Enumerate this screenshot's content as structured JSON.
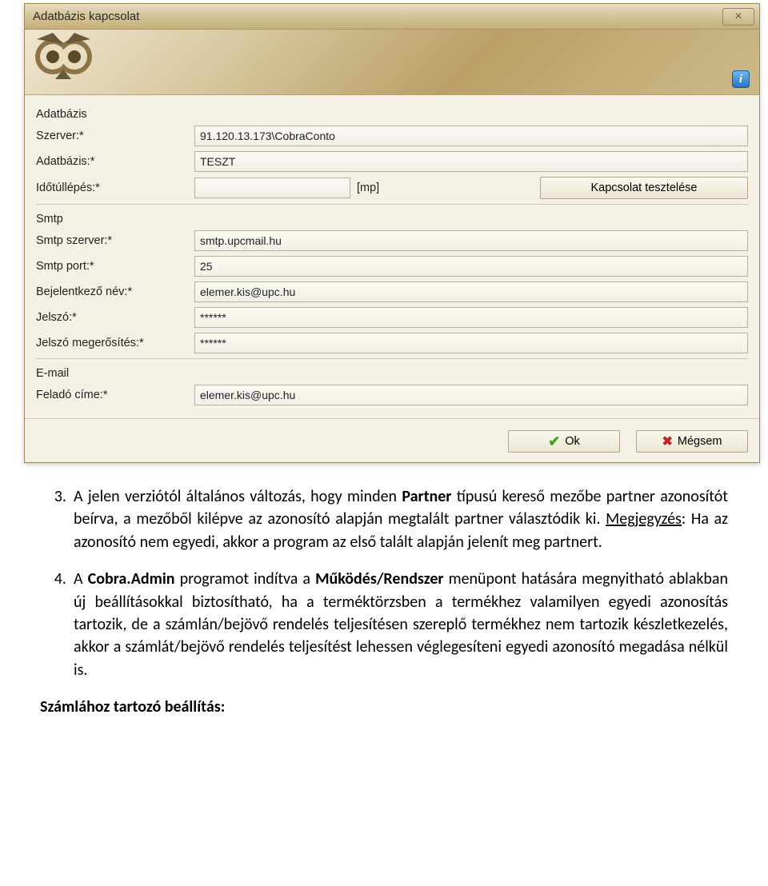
{
  "dialog": {
    "title": "Adatbázis kapcsolat",
    "info_char": "i",
    "close_char": "×",
    "sections": {
      "db": {
        "heading": "Adatbázis",
        "server_label": "Szerver:*",
        "server_value": "91.120.13.173\\CobraConto",
        "db_label": "Adatbázis:*",
        "db_value": "TESZT",
        "timeout_label": "Időtúllépés:*",
        "timeout_value": "",
        "timeout_unit": "[mp]",
        "test_btn": "Kapcsolat tesztelése"
      },
      "smtp": {
        "heading": "Smtp",
        "server_label": "Smtp szerver:*",
        "server_value": "smtp.upcmail.hu",
        "port_label": "Smtp port:*",
        "port_value": "25",
        "login_label": "Bejelntkező név:*",
        "login_label_fix": "Bejelentkező név:*",
        "login_value": "elemer.kis@upc.hu",
        "pass_label": "Jelszó:*",
        "pass_value": "******",
        "pass2_label": "Jelszó megerősítés:*",
        "pass2_value": "******"
      },
      "email": {
        "heading": "E-mail",
        "sender_label": "Feladó címe:*",
        "sender_value": "elemer.kis@upc.hu"
      }
    },
    "buttons": {
      "ok": "Ok",
      "cancel": "Mégsem"
    }
  },
  "document": {
    "item3_pre": "A jelen verziótól általános változás, hogy minden ",
    "item3_b1": "Partner",
    "item3_mid": " típusú kereső mezőbe partner azonosítót beírva, a mezőből kilépve az azonosító alapján megtalált partner választódik ki. ",
    "item3_u": "Megjegyzés",
    "item3_post": ": Ha az azonosító nem egyedi, akkor a program az első talált alapján jelenít meg partnert.",
    "item4_pre": "A ",
    "item4_b1": "Cobra.Admin",
    "item4_mid1": " programot indítva a ",
    "item4_b2": "Működés/Rendszer",
    "item4_post": " menüpont hatására megnyitható ablakban új beállításokkal biztosítható, ha a terméktörzsben a termékhez valamilyen egyedi azonosítás tartozik, de a számlán/bejövő rendelés teljesítésen szereplő termékhez nem tartozik készletkezelés, akkor a számlát/bejövő rendelés teljesítést lehessen véglegesíteni egyedi azonosító megadása nélkül is.",
    "heading": "Számlához tartozó beállítás:"
  }
}
